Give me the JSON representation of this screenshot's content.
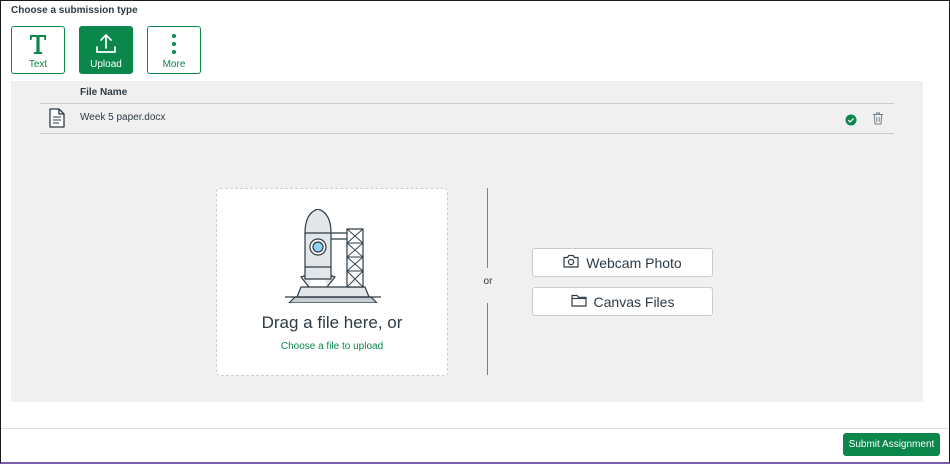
{
  "heading": "Choose a submission type",
  "types": [
    {
      "label": "Text",
      "icon": "text-icon"
    },
    {
      "label": "Upload",
      "icon": "upload-icon",
      "selected": true
    },
    {
      "label": "More",
      "icon": "more-vertical-icon"
    }
  ],
  "table": {
    "header": "File Name",
    "rows": [
      {
        "name": "Week 5 paper.docx",
        "status": "uploaded"
      }
    ]
  },
  "dropzone": {
    "title": "Drag a file here, or",
    "link": "Choose a file to upload"
  },
  "separator": "or",
  "options": {
    "webcam": "Webcam Photo",
    "canvas": "Canvas Files"
  },
  "submit_label": "Submit Assignment",
  "colors": {
    "accent": "#0b874b",
    "panel": "#f0f0f0",
    "text": "#2d3b45"
  }
}
